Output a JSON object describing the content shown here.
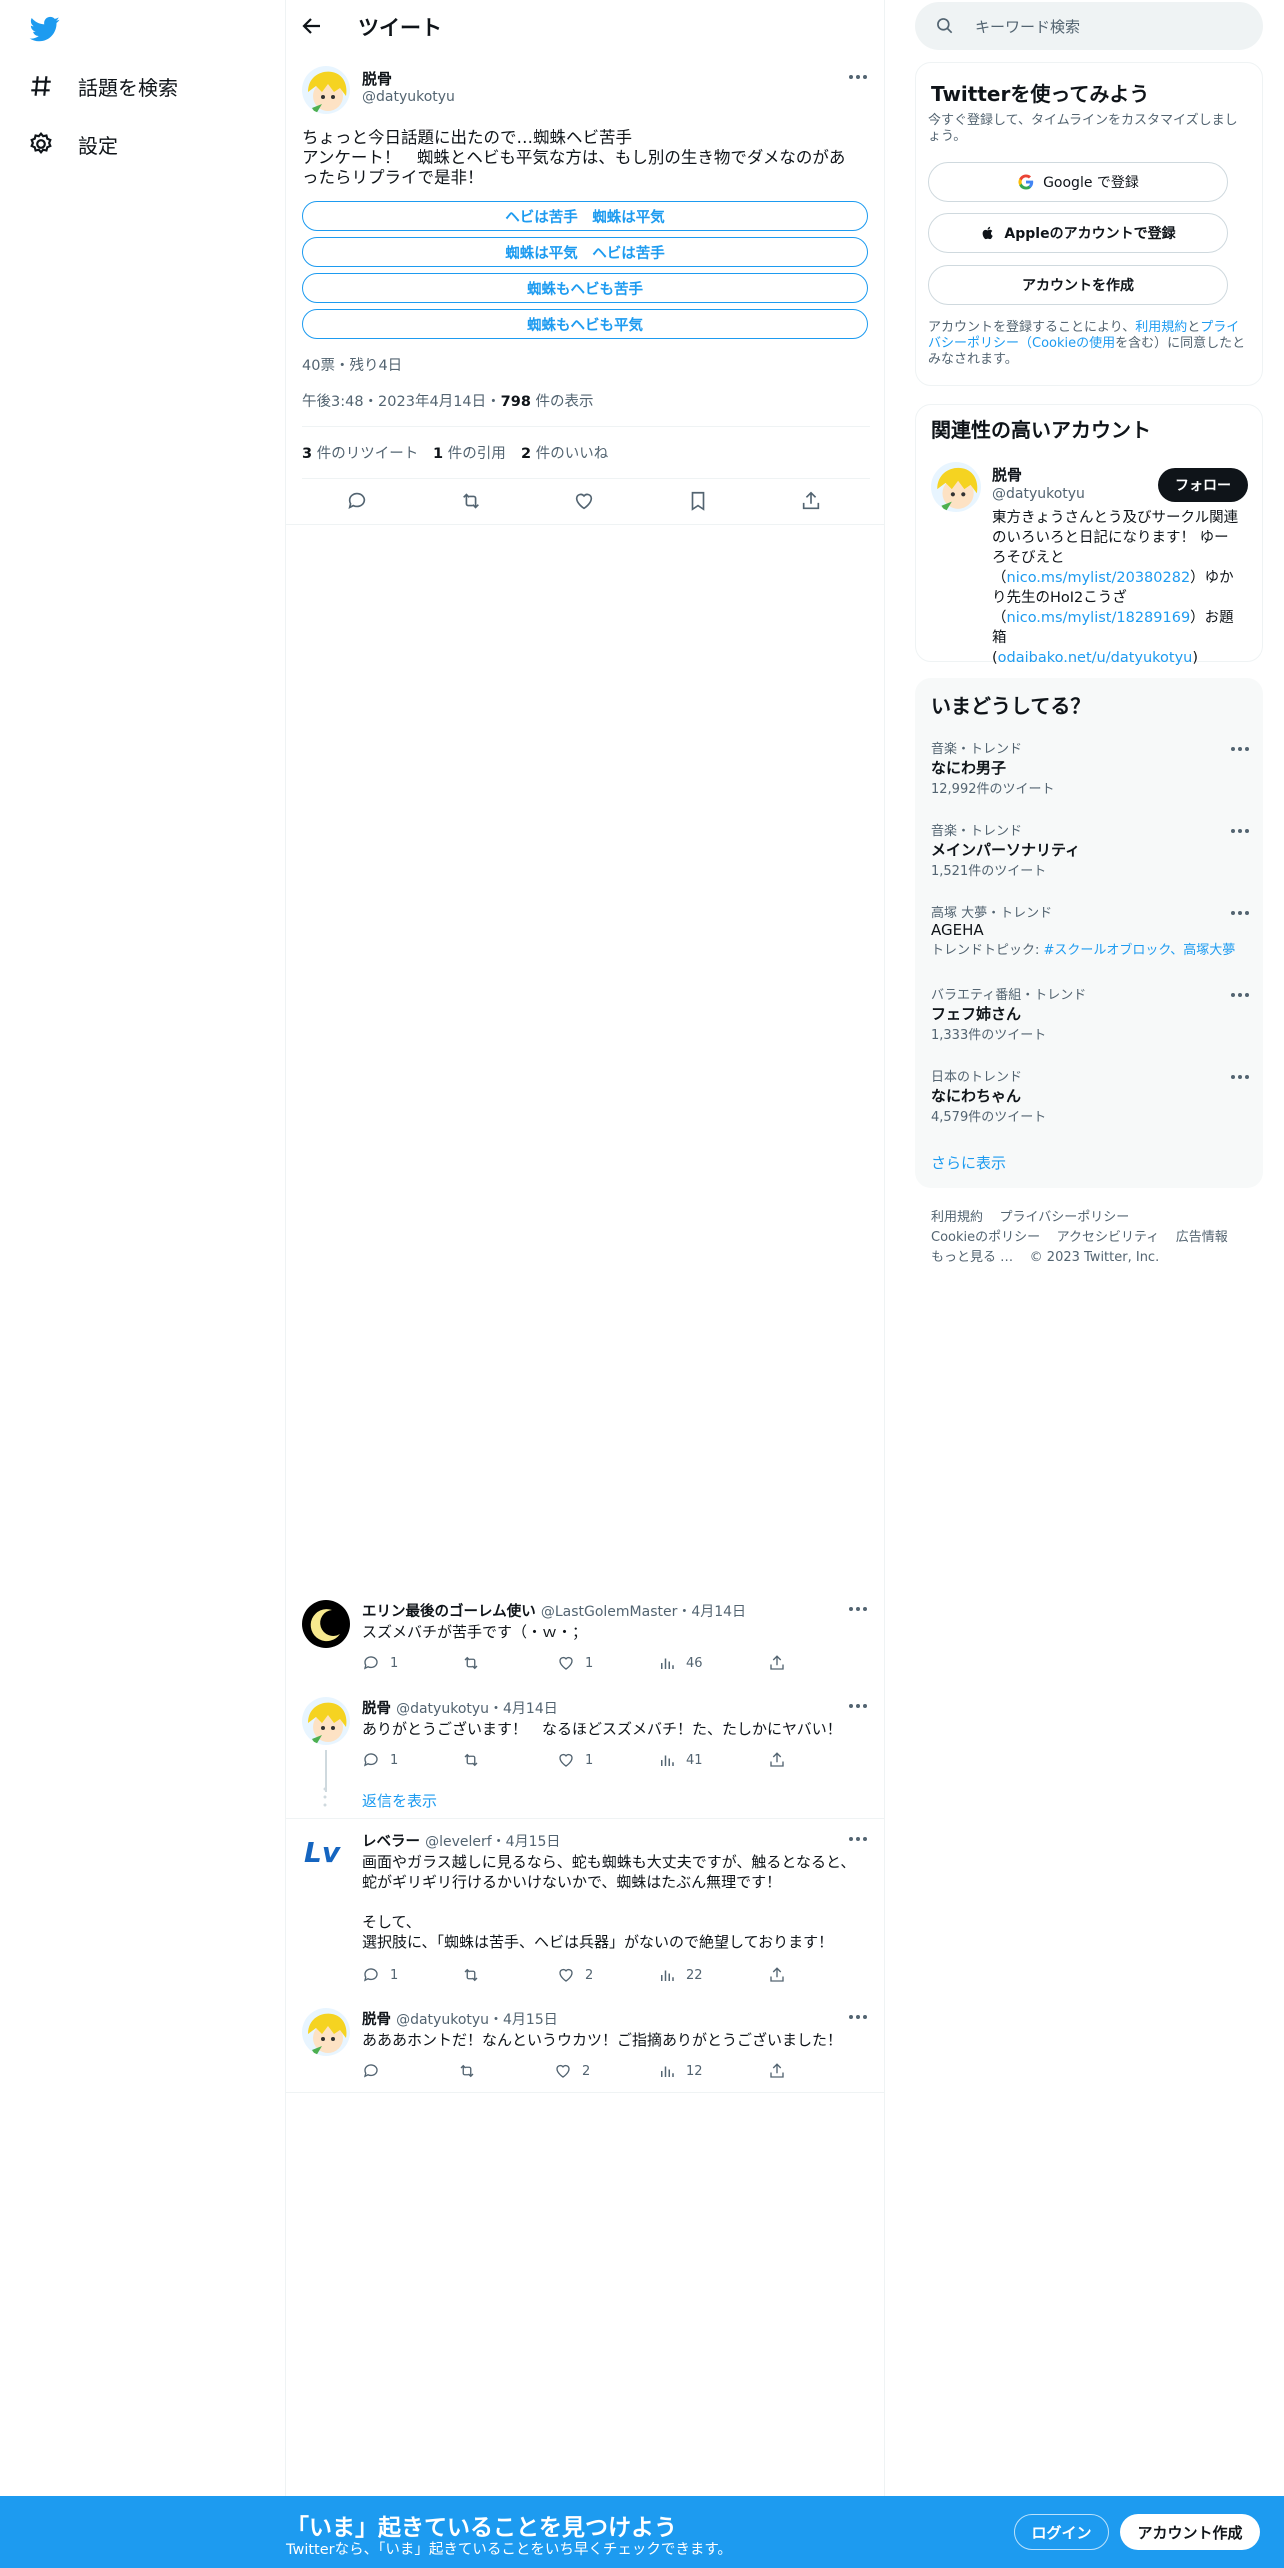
{
  "nav": {
    "explore_label": "話題を検索",
    "settings_label": "設定"
  },
  "header": {
    "title": "ツイート"
  },
  "tweet": {
    "author_name": "脱骨",
    "author_handle": "@datyukotyu",
    "text_line1": "ちょっと今日話題に出たので…蜘蛛ヘビ苦手",
    "text_line2": "アンケート！　蜘蛛とヘビも平気な方は、もし別の生き物でダメなのがあ",
    "text_line3": "ったらリプライで是非！",
    "poll_options": [
      "ヘビは苦手　蜘蛛は平気",
      "蜘蛛は平気　ヘビは苦手",
      "蜘蛛もヘビも苦手",
      "蜘蛛もヘビも平気"
    ],
    "poll_meta": "40票・残り4日",
    "timestamp": "午後3:48・2023年4月14日・",
    "views_count": "798",
    "views_label": " 件の表示",
    "retweets_count": "3",
    "retweets_label": " 件のリツイート",
    "quotes_count": "1",
    "quotes_label": " 件の引用",
    "likes_count": "2",
    "likes_label": " 件のいいね"
  },
  "replies": [
    {
      "name": "エリン最後のゴーレム使い",
      "meta": "@LastGolemMaster・4月14日",
      "text": "スズメバチが苦手です（・ｗ・；",
      "replies": "1",
      "likes": "1",
      "views": "46"
    },
    {
      "name": "脱骨",
      "meta": "@datyukotyu・4月14日",
      "text": "ありがとうございます！　なるほどスズメバチ！た、たしかにヤバい！",
      "replies": "1",
      "likes": "1",
      "views": "41"
    },
    {
      "show_replies": "返信を表示"
    },
    {
      "name": "レベラー",
      "meta": "@levelerf・4月15日",
      "text_line1": "画面やガラス越しに見るなら、蛇も蜘蛛も大丈夫ですが、触るとなると、",
      "text_line2": "蛇がギリギリ行けるかいけないかで、蜘蛛はたぶん無理です！",
      "text_line3": "そして、",
      "text_line4": "選択肢に、「蜘蛛は苦手、ヘビは兵器」がないので絶望しております！",
      "replies": "1",
      "likes": "2",
      "views": "22"
    },
    {
      "name": "脱骨",
      "meta": "@datyukotyu・4月15日",
      "text": "あああホントだ！なんというウカツ！ご指摘ありがとうございました！",
      "likes": "2",
      "views": "12"
    }
  ],
  "search": {
    "placeholder": "キーワード検索"
  },
  "signup_card": {
    "title": "Twitterを使ってみよう",
    "subtitle_line1": "今すぐ登録して、タイムラインをカスタマイズしまし",
    "subtitle_line2": "ょう。",
    "google_label": "Google で登録",
    "apple_label": "Appleのアカウントで登録",
    "create_label": "アカウントを作成",
    "legal_prefix": "アカウントを登録することにより、",
    "legal_terms": "利用規約",
    "legal_and": "と",
    "legal_privacy1": "プライ",
    "legal_privacy2": "バシーポリシー",
    "legal_cookie": "（Cookieの使用",
    "legal_suffix1": "を含む）に同意したと",
    "legal_suffix2": "みなされます。"
  },
  "related_card": {
    "title": "関連性の高いアカウント",
    "name": "脱骨",
    "handle": "@datyukotyu",
    "follow_label": "フォロー",
    "bio_line1": "東方きょうさんとう及びサークル関連",
    "bio_line2": "のいろいろと日記になります！ ゆー",
    "bio_line3": "ろそびえと",
    "bio_link1": "nico.ms/mylist/20380282",
    "bio_after1": "）ゆか",
    "bio_line5": "り先生のHoI2こうざ",
    "bio_link2": "nico.ms/mylist/18289169",
    "bio_after2": "）お題箱",
    "bio_link3": "odaibako.net/u/datyukotyu"
  },
  "trends_card": {
    "title": "いまどうしてる？",
    "trends": [
      {
        "category": "音楽・トレンド",
        "name": "なにわ男子",
        "count": "12,992件のツイート"
      },
      {
        "category": "音楽・トレンド",
        "name": "メインパーソナリティ",
        "count": "1,521件のツイート"
      },
      {
        "category": "高塚 大夢・トレンド",
        "name": "AGEHA",
        "count_prefix": "トレンドトピック: ",
        "count_links": "#スクールオブロック、高塚大夢"
      },
      {
        "category": "バラエティ番組・トレンド",
        "name": "フェフ姉さん",
        "count": "1,333件のツイート"
      },
      {
        "category": "日本のトレンド",
        "name": "なにわちゃん",
        "count": "4,579件のツイート"
      }
    ],
    "show_more": "さらに表示"
  },
  "footer": {
    "terms": "利用規約",
    "privacy": "プライバシーポリシー",
    "cookie": "Cookieのポリシー",
    "accessibility": "アクセシビリティ",
    "ads": "広告情報",
    "more": "もっと見る …",
    "copyright": "© 2023 Twitter, Inc."
  },
  "bottom_bar": {
    "title": "「いま」起きていることを見つけよう",
    "subtitle": "Twitterなら、「いま」起きていることをいち早くチェックできます。",
    "login": "ログイン",
    "signup": "アカウント作成"
  },
  "colors": {
    "accent": "#1d9bf0",
    "text": "#0f1419",
    "muted": "#536471"
  }
}
